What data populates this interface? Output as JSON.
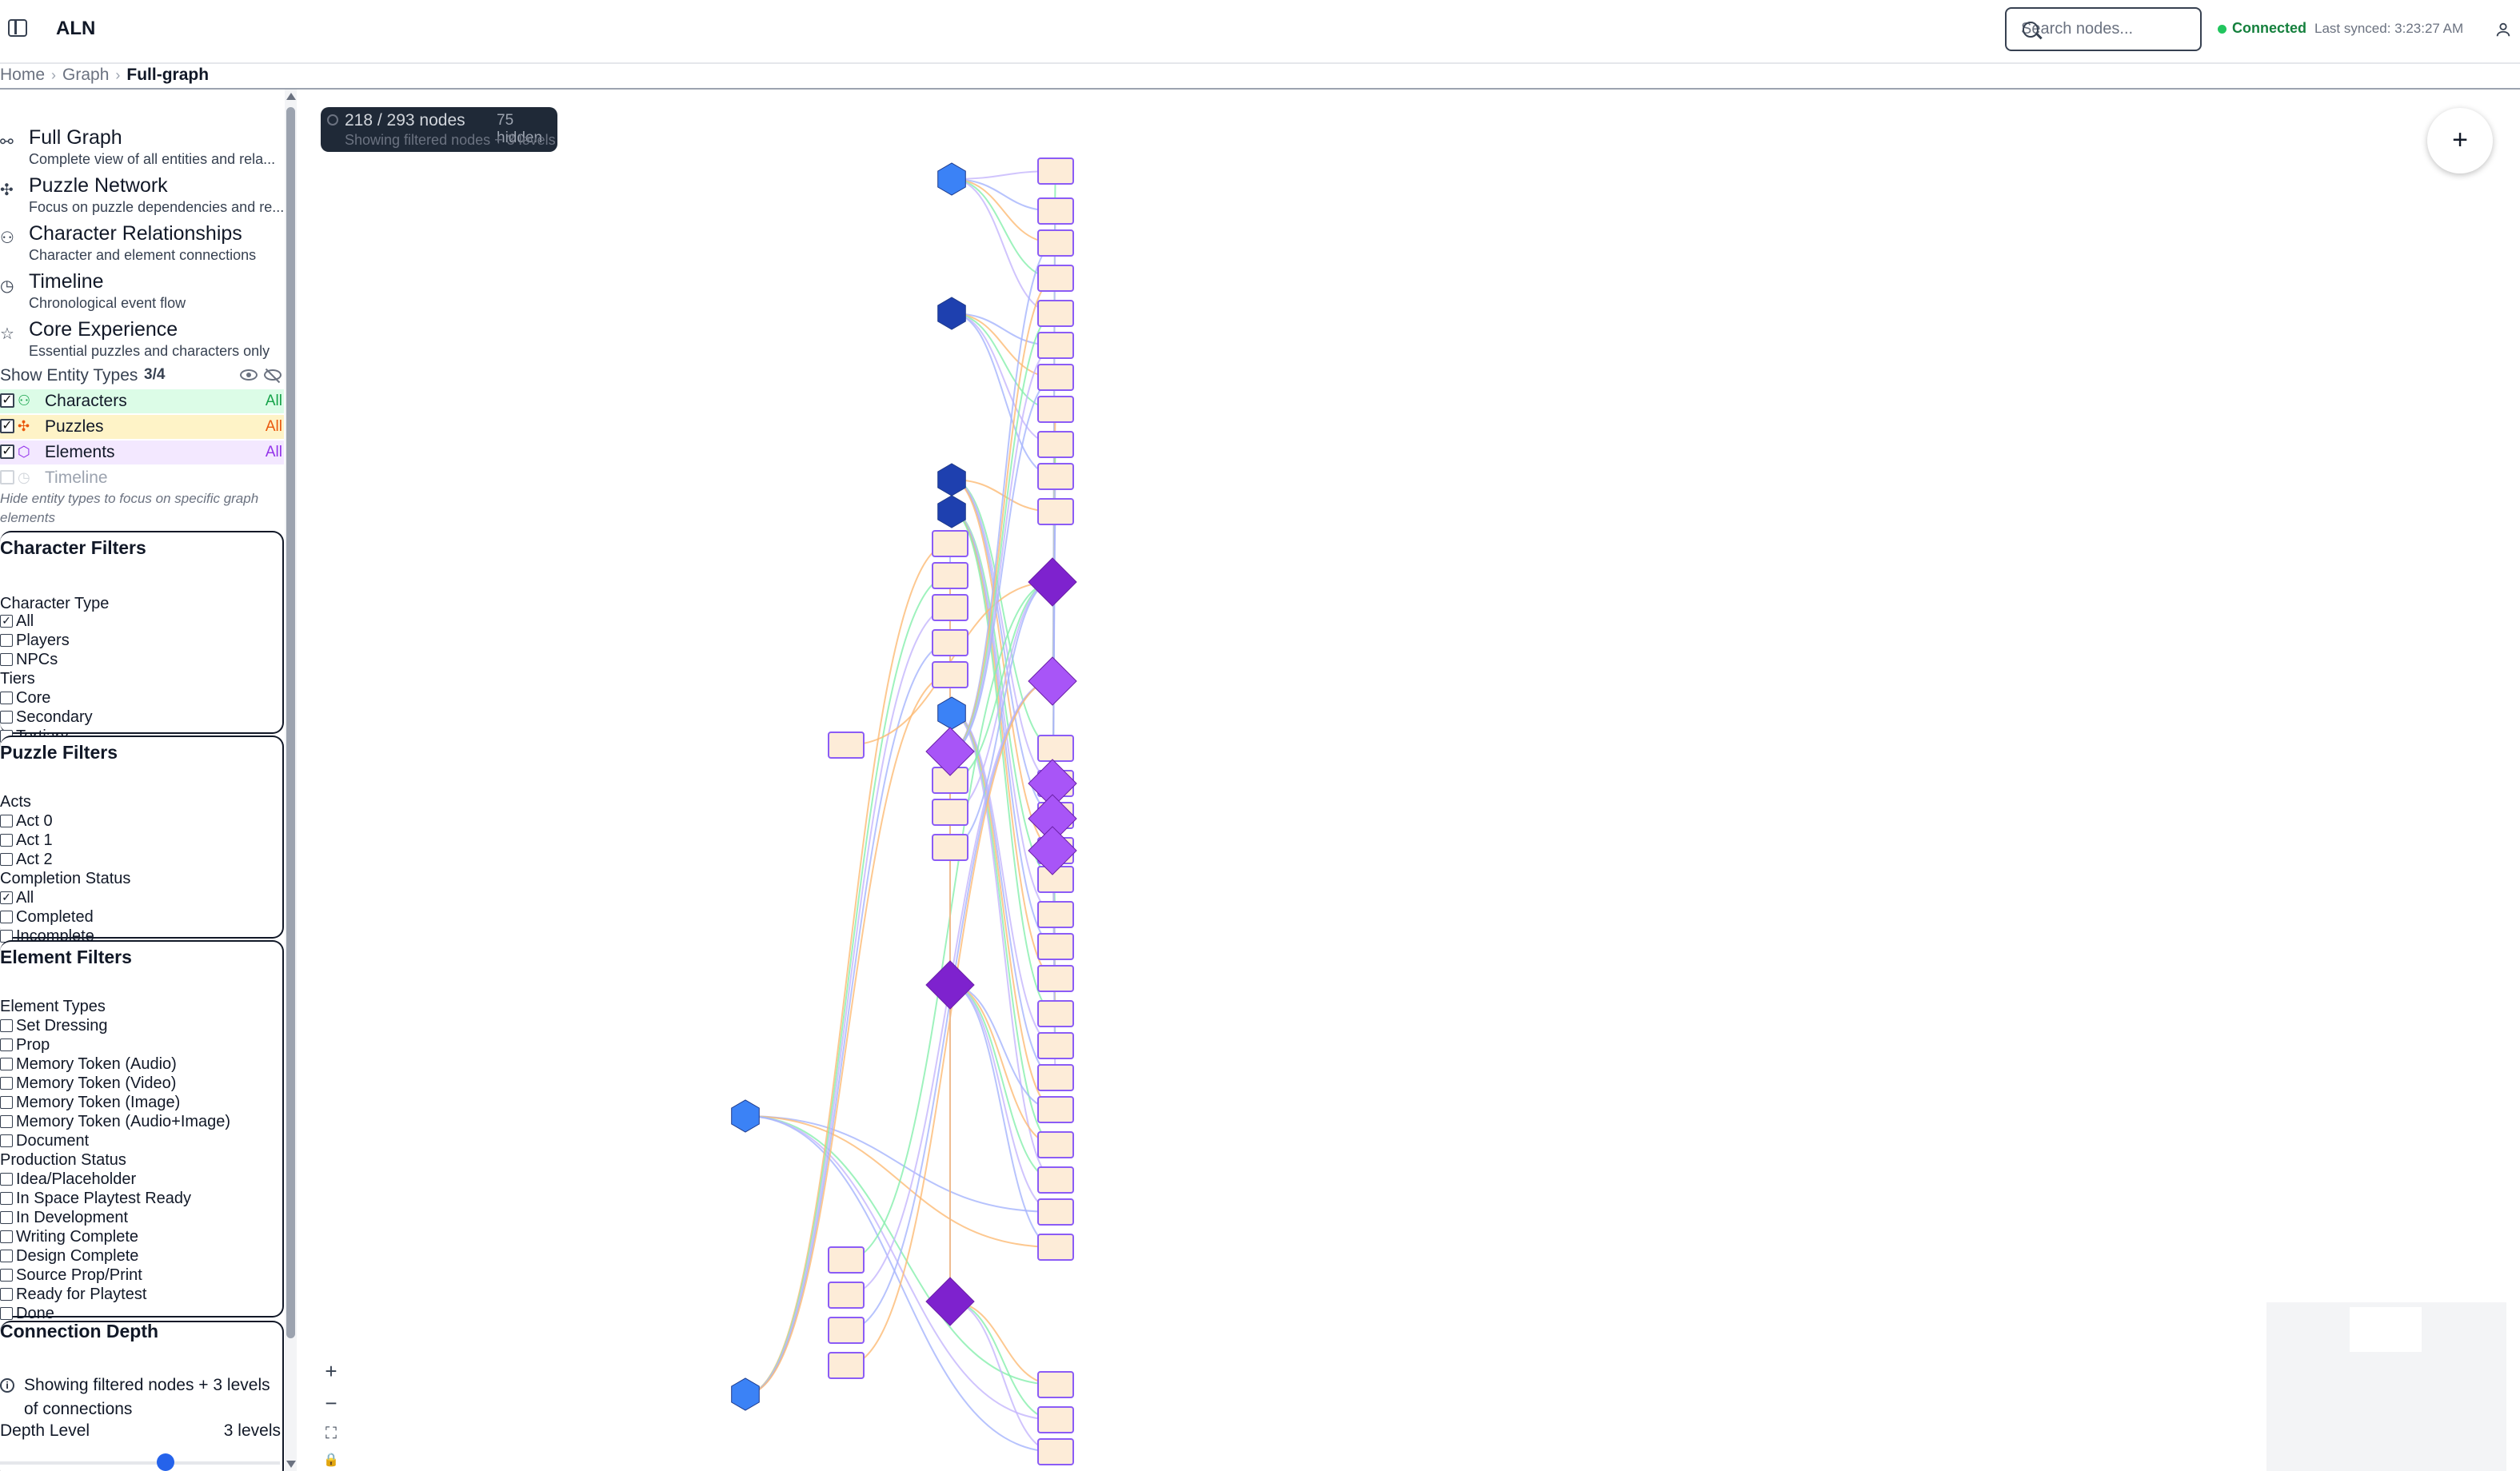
{
  "header": {
    "app_name": "ALN",
    "search_placeholder": "Search nodes...",
    "status": "Connected",
    "last_synced": "Last synced: 3:23:27 AM",
    "status_color": "#22c55e"
  },
  "breadcrumb": {
    "items": [
      "Home",
      "Graph",
      "Full-graph"
    ]
  },
  "views": [
    {
      "title": "Full Graph",
      "desc": "Complete view of all entities and rela...",
      "icon": "network-icon"
    },
    {
      "title": "Puzzle Network",
      "desc": "Focus on puzzle dependencies and re...",
      "icon": "puzzle-icon"
    },
    {
      "title": "Character Relationships",
      "desc": "Character and element connections",
      "icon": "users-icon"
    },
    {
      "title": "Timeline",
      "desc": "Chronological event flow",
      "icon": "clock-icon"
    },
    {
      "title": "Core Experience",
      "desc": "Essential puzzles and characters only",
      "icon": "star-icon"
    }
  ],
  "entity_types": {
    "title": "Show Entity Types",
    "count": "3/4",
    "items": [
      {
        "name": "Characters",
        "badge": "All",
        "checked": true,
        "color": "#16a34a",
        "bg": "#dcfce7"
      },
      {
        "name": "Puzzles",
        "badge": "All",
        "checked": true,
        "color": "#ea580c",
        "bg": "#fef3c7"
      },
      {
        "name": "Elements",
        "badge": "All",
        "checked": true,
        "color": "#9333ea",
        "bg": "#f3e8ff"
      },
      {
        "name": "Timeline",
        "badge": "",
        "checked": false,
        "color": "#9ca3af",
        "bg": "#ffffff"
      }
    ],
    "hint": "Hide entity types to focus on specific graph elements"
  },
  "character_filters": {
    "title": "Character Filters",
    "type_label": "Character Type",
    "types": [
      {
        "label": "All",
        "checked": true
      },
      {
        "label": "Players",
        "checked": false
      },
      {
        "label": "NPCs",
        "checked": false
      }
    ],
    "tiers_label": "Tiers",
    "tiers": [
      {
        "label": "Core",
        "checked": false
      },
      {
        "label": "Secondary",
        "checked": false
      },
      {
        "label": "Tertiary",
        "checked": false
      }
    ]
  },
  "puzzle_filters": {
    "title": "Puzzle Filters",
    "acts_label": "Acts",
    "acts": [
      {
        "label": "Act 0",
        "checked": false
      },
      {
        "label": "Act 1",
        "checked": false
      },
      {
        "label": "Act 2",
        "checked": false
      }
    ],
    "status_label": "Completion Status",
    "statuses": [
      {
        "label": "All",
        "checked": true
      },
      {
        "label": "Completed",
        "checked": false
      },
      {
        "label": "Incomplete",
        "checked": false
      }
    ]
  },
  "element_filters": {
    "title": "Element Filters",
    "types_label": "Element Types",
    "types": [
      {
        "label": "Set Dressing",
        "checked": false
      },
      {
        "label": "Prop",
        "checked": false
      },
      {
        "label": "Memory Token (Audio)",
        "checked": false
      },
      {
        "label": "Memory Token (Video)",
        "checked": false
      },
      {
        "label": "Memory Token (Image)",
        "checked": false
      },
      {
        "label": "Memory Token (Audio+Image)",
        "checked": false
      },
      {
        "label": "Document",
        "checked": false
      }
    ],
    "production_label": "Production Status",
    "production": [
      {
        "label": "Idea/Placeholder",
        "checked": false
      },
      {
        "label": "In Space Playtest Ready",
        "checked": false
      },
      {
        "label": "In Development",
        "checked": false
      },
      {
        "label": "Writing Complete",
        "checked": false
      },
      {
        "label": "Design Complete",
        "checked": false
      },
      {
        "label": "Source Prop/Print",
        "checked": false
      },
      {
        "label": "Ready for Playtest",
        "checked": false
      },
      {
        "label": "Done",
        "checked": false
      }
    ]
  },
  "connection_depth": {
    "title": "Connection Depth",
    "info": "Showing filtered nodes + 3 levels of connections",
    "label": "Depth Level",
    "value": "3 levels",
    "level": 3
  },
  "canvas": {
    "node_count": "218 / 293 nodes",
    "hidden": "75 hidden",
    "filter_note": "Showing filtered nodes + 3 levels",
    "add_label": "+",
    "zoom_in": "+",
    "zoom_out": "−",
    "fit": "⛶",
    "lock": "🔒"
  },
  "colors": {
    "character_node": "#3b82f6",
    "character_node_dark": "#1e40af",
    "puzzle_node": "#a855f7",
    "puzzle_node_dark": "#7e22ce",
    "element_fill": "#fdecd8",
    "element_stroke": "#8b5cf6"
  }
}
